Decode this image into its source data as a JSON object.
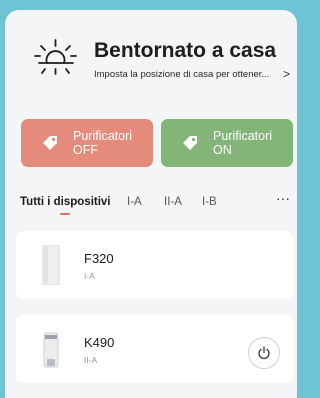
{
  "welcome": {
    "title": "Bentornato a casa",
    "subtitle": "Imposta la posizione di casa per ottener...",
    "chevron": ">",
    "icon": "sun-icon"
  },
  "actions": {
    "off": {
      "line1": "Purificatori",
      "line2": "OFF",
      "color": "#e48b7b",
      "icon": "tag-icon"
    },
    "on": {
      "line1": "Purificatori",
      "line2": "ON",
      "color": "#83b579",
      "icon": "tag-icon"
    }
  },
  "tabs": [
    {
      "label": "Tutti i dispositivi",
      "active": true
    },
    {
      "label": "I-A",
      "active": false
    },
    {
      "label": "II-A",
      "active": false
    },
    {
      "label": "I-B",
      "active": false
    }
  ],
  "more_label": "···",
  "devices": [
    {
      "name": "F320",
      "room": "I-A",
      "has_power": false
    },
    {
      "name": "K490",
      "room": "II-A",
      "has_power": true
    }
  ],
  "colors": {
    "background": "#6ec3d4",
    "accent": "#e8705a",
    "off_button": "#e48b7b",
    "on_button": "#83b579"
  }
}
